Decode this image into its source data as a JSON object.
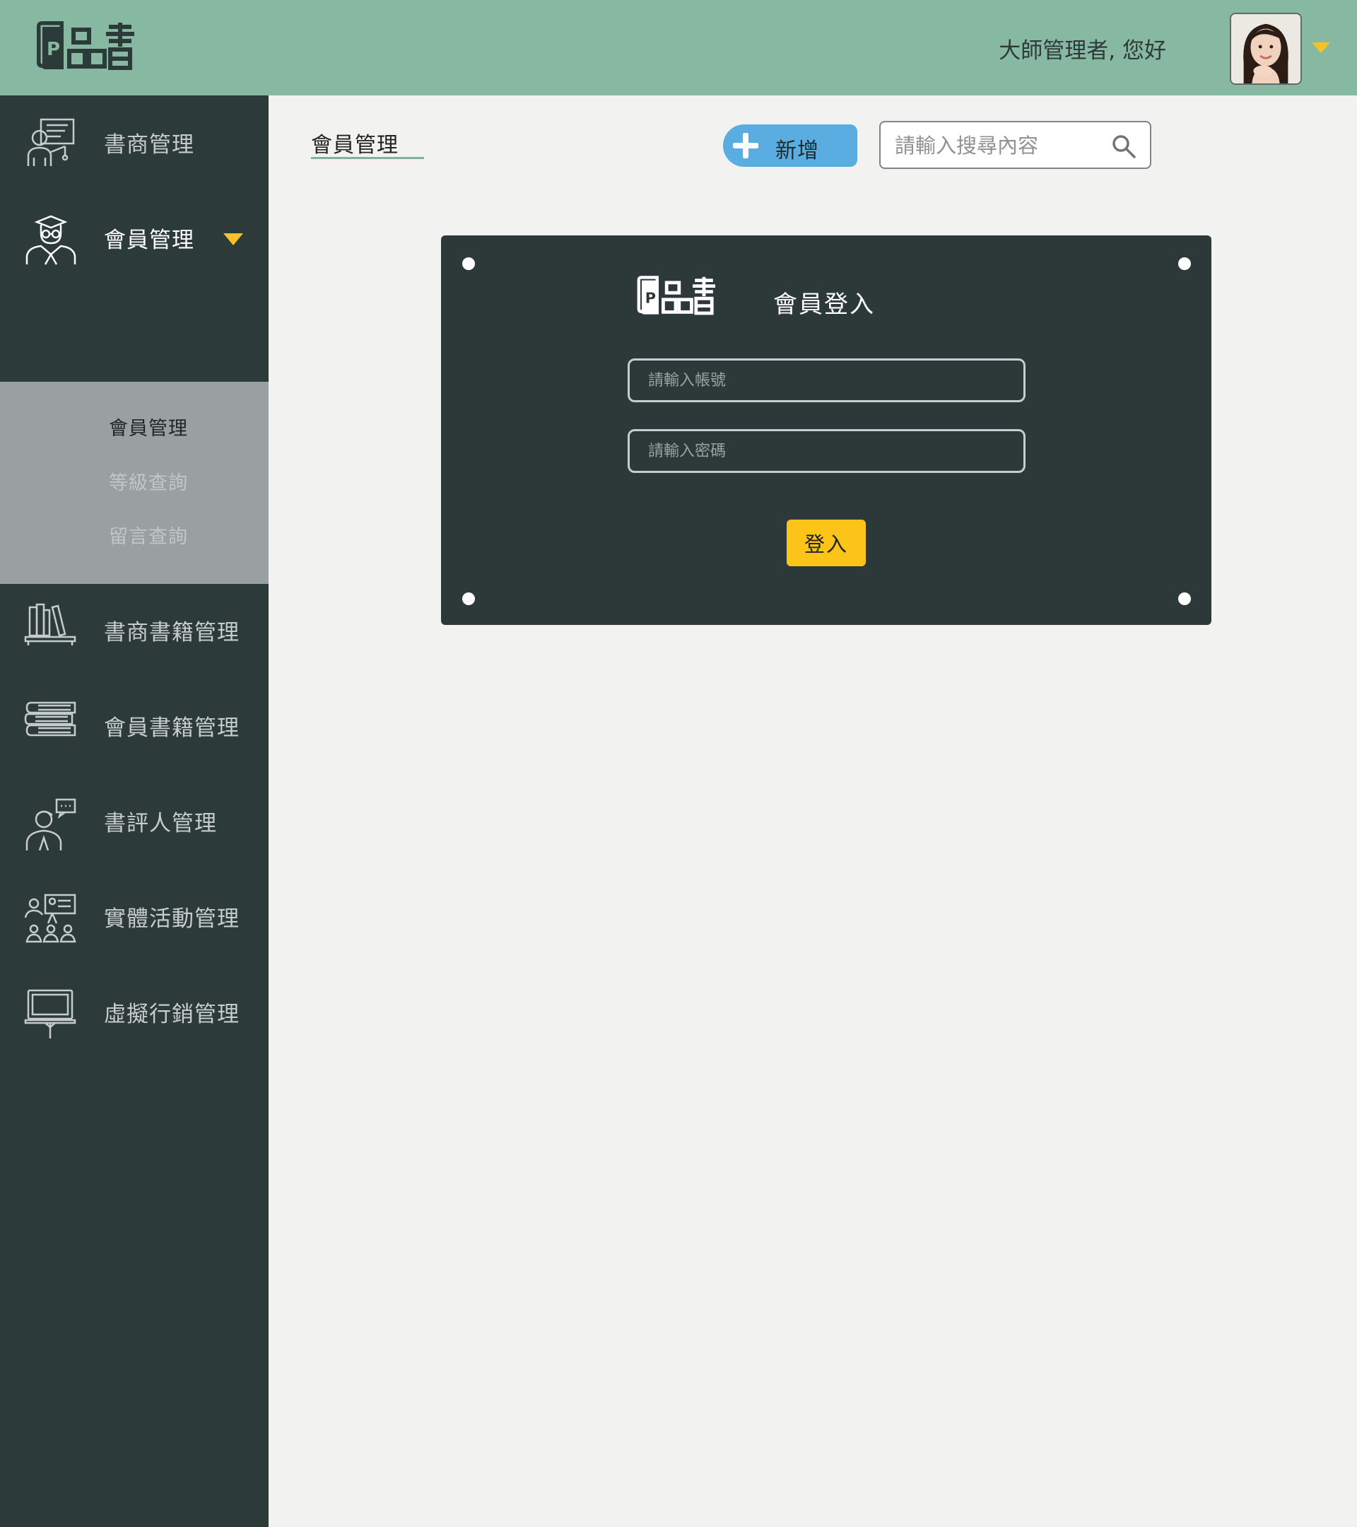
{
  "app": {
    "logo_text": "P品書"
  },
  "header": {
    "greeting": "大師管理者, 您好"
  },
  "sidebar": {
    "items": [
      {
        "label": "書商管理",
        "icon": "bookseller-icon"
      },
      {
        "label": "會員管理",
        "icon": "member-icon",
        "active": true
      },
      {
        "label": "書商書籍管理",
        "icon": "bookshelf-icon"
      },
      {
        "label": "會員書籍管理",
        "icon": "book-stack-icon"
      },
      {
        "label": "書評人管理",
        "icon": "reviewer-icon"
      },
      {
        "label": "實體活動管理",
        "icon": "event-icon"
      },
      {
        "label": "虛擬行銷管理",
        "icon": "monitor-icon"
      }
    ],
    "submenu": [
      {
        "label": "會員管理",
        "selected": true
      },
      {
        "label": "等級查詢"
      },
      {
        "label": "留言查詢"
      }
    ]
  },
  "main": {
    "title": "會員管理",
    "add_label": "新增",
    "search_placeholder": "請輸入搜尋內容"
  },
  "login": {
    "title": "會員登入",
    "account_placeholder": "請輸入帳號",
    "password_placeholder": "請輸入密碼",
    "submit_label": "登入"
  },
  "colors": {
    "header_bg": "#87b8a2",
    "sidebar_bg": "#2d3a3a",
    "submenu_bg": "#9aa09f",
    "accent_yellow": "#f6c22a",
    "add_button_blue": "#5aade0",
    "panel_bg": "#2d3838"
  }
}
